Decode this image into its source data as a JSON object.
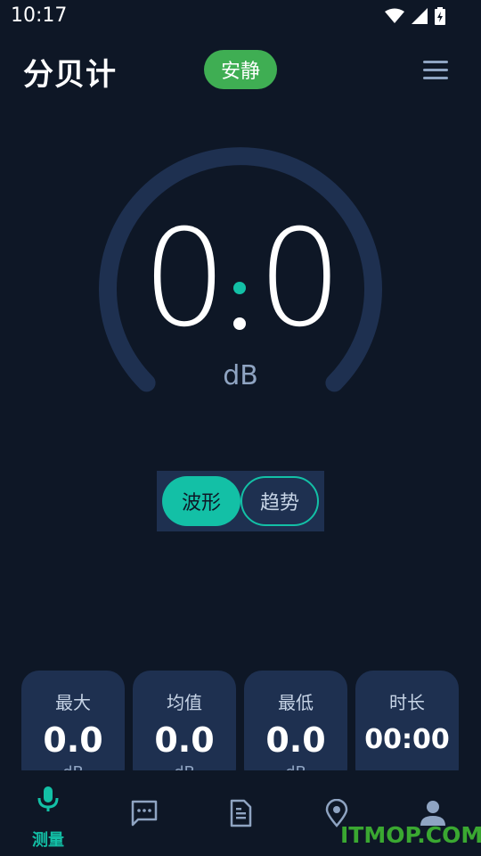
{
  "status_bar": {
    "time": "10:17"
  },
  "header": {
    "title": "分贝计",
    "level_badge": "安静"
  },
  "meter": {
    "value": "0.0",
    "value_int": "0",
    "value_dec": "0",
    "unit": "dB",
    "level_fraction": 0
  },
  "mode_toggle": {
    "wave": "波形",
    "trend": "趋势",
    "selected": "wave"
  },
  "stats": [
    {
      "label": "最大",
      "value": "0.0",
      "unit": "dB"
    },
    {
      "label": "均值",
      "value": "0.0",
      "unit": "dB"
    },
    {
      "label": "最低",
      "value": "0.0",
      "unit": "dB"
    },
    {
      "label": "时长",
      "value": "00:00",
      "unit": ""
    }
  ],
  "nav": {
    "measure_label": "测量"
  },
  "watermark": "ITMOP.COM",
  "colors": {
    "background": "#0e1726",
    "card": "#1e3050",
    "accent": "#13c0a6",
    "badge": "#3fae53",
    "muted": "#8fa4c2"
  },
  "icons": {
    "status": [
      "wifi-icon",
      "signal-icon",
      "battery-charging-icon"
    ],
    "nav": [
      "microphone-icon",
      "chat-icon",
      "document-icon",
      "location-pin-icon",
      "person-icon"
    ]
  }
}
